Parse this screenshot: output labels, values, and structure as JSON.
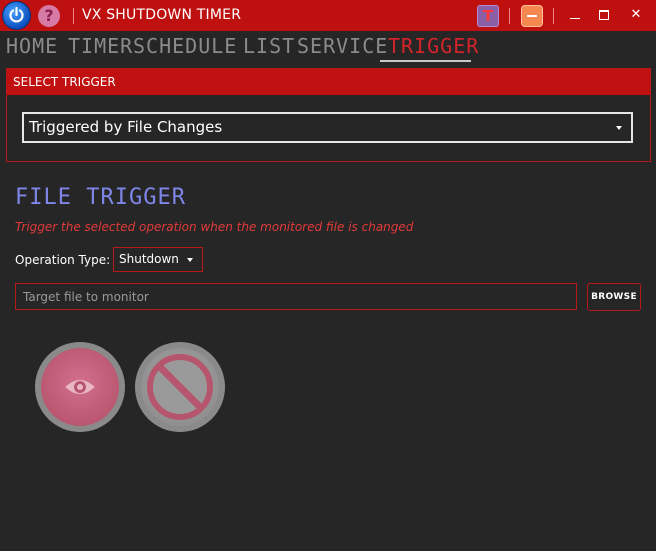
{
  "window": {
    "title": "VX SHUTDOWN TIMER",
    "help_glyph": "?",
    "t_glyph": "T",
    "close_glyph": "✕"
  },
  "menu": {
    "items": [
      {
        "label": "HOME",
        "active": false
      },
      {
        "label": "TIMER",
        "active": false
      },
      {
        "label": "SCHEDULE",
        "active": false
      },
      {
        "label": "LIST",
        "active": false
      },
      {
        "label": "SERVICE",
        "active": false
      },
      {
        "label": "TRIGGER",
        "active": true
      }
    ]
  },
  "select_trigger": {
    "header": "SELECT TRIGGER",
    "selected": "Triggered by File Changes"
  },
  "file_trigger": {
    "title": "FILE TRIGGER",
    "description": "Trigger the selected operation when the monitored file is changed",
    "operation_label": "Operation Type:",
    "operation_value": "Shutdown",
    "file_placeholder": "Target file to monitor",
    "file_value": "",
    "browse_label": "BROWSE"
  },
  "icons": {
    "power": "power-icon",
    "help": "help-icon",
    "watch": "eye-icon",
    "stop": "stop-icon"
  },
  "colors": {
    "accent_red": "#bf1010",
    "title_blue": "#7f86e8",
    "description_red": "#e23a3a",
    "background": "#262626"
  }
}
